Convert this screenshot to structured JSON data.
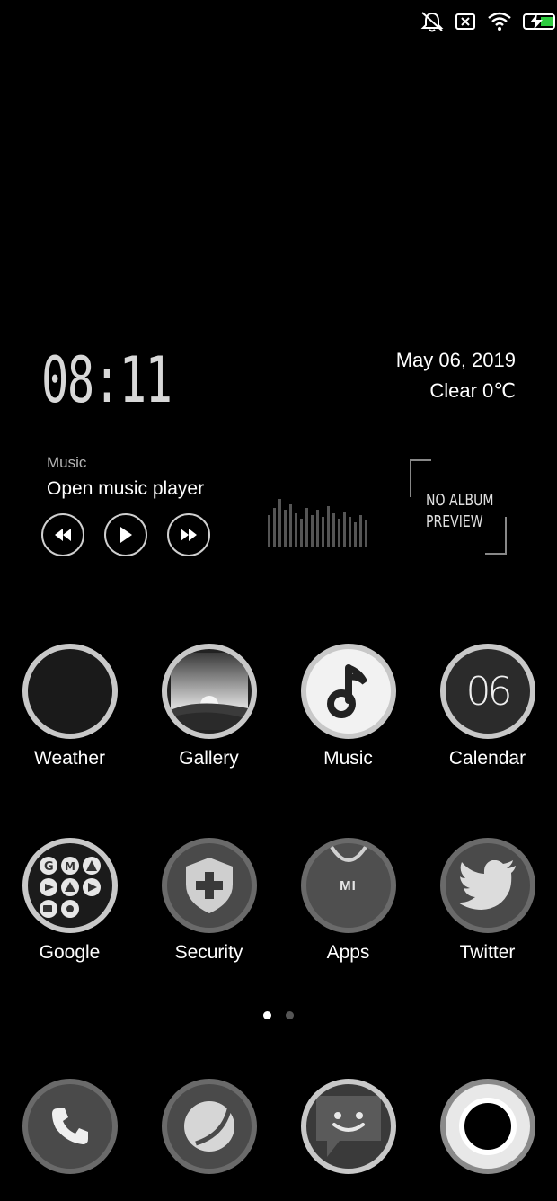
{
  "clock": {
    "time": "08:11"
  },
  "date": {
    "date_text": "May  06, 2019",
    "weather_text": "Clear  0℃"
  },
  "music_widget": {
    "caption": "Music",
    "title": "Open music player",
    "album_line1": "NO ALBUM",
    "album_line2": "PREVIEW"
  },
  "row1": [
    {
      "label": "Weather",
      "icon": "weather-icon"
    },
    {
      "label": "Gallery",
      "icon": "gallery-icon"
    },
    {
      "label": "Music",
      "icon": "music-note-icon"
    },
    {
      "label": "Calendar",
      "icon": "calendar-icon",
      "day": "06"
    }
  ],
  "row2": [
    {
      "label": "Google",
      "icon": "google-folder-icon"
    },
    {
      "label": "Security",
      "icon": "shield-plus-icon"
    },
    {
      "label": "Apps",
      "icon": "mi-shopping-bag-icon",
      "badge": "MI"
    },
    {
      "label": "Twitter",
      "icon": "twitter-bird-icon"
    }
  ],
  "dock": [
    {
      "icon": "phone-icon"
    },
    {
      "icon": "browser-icon"
    },
    {
      "icon": "messaging-icon"
    },
    {
      "icon": "camera-icon"
    }
  ],
  "page_indicator": {
    "pages": 2,
    "active": 0
  },
  "colors": {
    "background": "#000000",
    "icon_ring": "#c8c8c8",
    "icon_gray": "#4a4a4a"
  }
}
